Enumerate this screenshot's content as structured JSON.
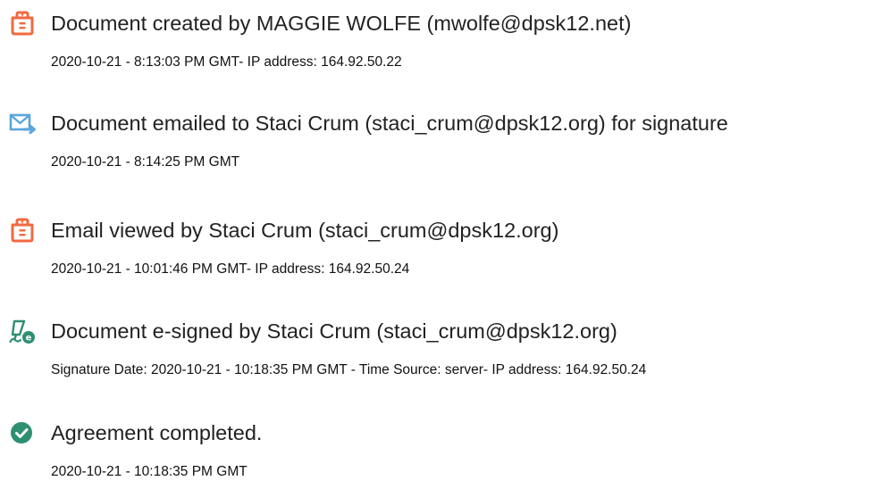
{
  "audit_events": [
    {
      "icon": "document-created-icon",
      "title": "Document created by MAGGIE WOLFE (mwolfe@dpsk12.net)",
      "detail": "2020-10-21 - 8:13:03 PM GMT- IP address: 164.92.50.22"
    },
    {
      "icon": "email-sent-icon",
      "title": "Document emailed to Staci Crum (staci_crum@dpsk12.org) for signature",
      "detail": "2020-10-21 - 8:14:25 PM GMT"
    },
    {
      "icon": "email-viewed-icon",
      "title": "Email viewed by Staci Crum (staci_crum@dpsk12.org)",
      "detail": "2020-10-21 - 10:01:46 PM GMT- IP address: 164.92.50.24"
    },
    {
      "icon": "e-signed-icon",
      "title": "Document e-signed by Staci Crum (staci_crum@dpsk12.org)",
      "detail": "Signature Date: 2020-10-21 - 10:18:35 PM GMT - Time Source: server- IP address: 164.92.50.24"
    },
    {
      "icon": "checkmark-circle-icon",
      "title": "Agreement completed.",
      "detail": "2020-10-21 - 10:18:35 PM GMT"
    }
  ],
  "colors": {
    "document_icon": "#f06a3f",
    "email_icon": "#5aa6dc",
    "signature_icon": "#2e8f72",
    "completed_icon": "#2e8f72"
  }
}
